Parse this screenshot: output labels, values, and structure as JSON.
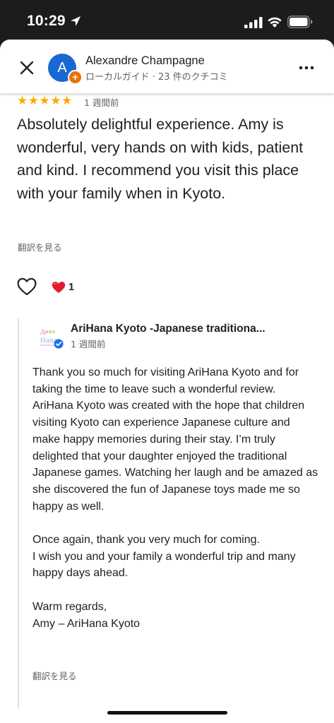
{
  "status_bar": {
    "time": "10:29"
  },
  "header": {
    "reviewer_name": "Alexandre Champagne",
    "reviewer_meta": "ローカルガイド · 23 件のクチコミ",
    "avatar_initial": "A",
    "badge_symbol": "+"
  },
  "review": {
    "rating": 5,
    "stars": "★★★★★",
    "date": "1 週間前",
    "text": "Absolutely delightful experience. Amy is wonderful, very hands on with kids, patient and kind. I recommend you visit this place with your family when in Kyoto.",
    "translate_label": "翻訳を見る",
    "reaction_count": "1"
  },
  "owner_response": {
    "name": "AriHana Kyoto -Japanese traditiona...",
    "date": "1 週間前",
    "paragraphs": [
      "Thank you so much for visiting AriHana Kyoto and for taking the time to leave such a wonderful review.\nAriHana Kyoto was created with the hope that children visiting Kyoto can experience Japanese culture and make happy memories during their stay. I’m truly delighted that your daughter enjoyed the traditional Japanese games. Watching her laugh and be amazed as she discovered the fun of Japanese toys made me so happy as well.",
      "Once again, thank you very much for coming.\nI wish you and your family a wonderful trip and many happy days ahead.",
      "Warm regards,\nAmy – AriHana Kyoto"
    ],
    "translate_label": "翻訳を見る"
  },
  "colors": {
    "star": "#f9ab00",
    "avatar": "#1967d2",
    "badge": "#e8710a",
    "heart": "#e11d2a",
    "verified": "#1a73e8"
  },
  "icons": {
    "close": "close-icon",
    "more": "more-vert-icon",
    "like": "heart-outline-icon",
    "reaction": "red-heart-icon",
    "verified": "verified-check-icon"
  }
}
